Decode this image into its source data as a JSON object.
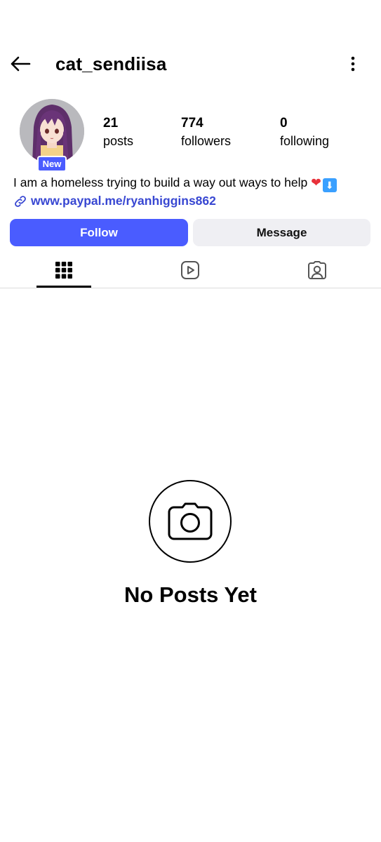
{
  "header": {
    "username": "cat_sendiisa",
    "back_icon": "arrow-left-icon",
    "more_icon": "more-vertical-icon"
  },
  "profile": {
    "badge": "New",
    "stats": {
      "posts": {
        "value": "21",
        "label": "posts"
      },
      "followers": {
        "value": "774",
        "label": "followers"
      },
      "following": {
        "value": "0",
        "label": "following"
      }
    },
    "bio": "I am a homeless trying to build a way out ways to help ",
    "bio_emoji_1": "❤",
    "bio_emoji_2": "⬇",
    "link": "www.paypal.me/ryanhiggins862"
  },
  "actions": {
    "follow_label": "Follow",
    "message_label": "Message"
  },
  "tabs": [
    {
      "icon": "grid-icon",
      "active": true
    },
    {
      "icon": "reels-icon",
      "active": false
    },
    {
      "icon": "tagged-icon",
      "active": false
    }
  ],
  "empty_state": {
    "icon": "camera-icon",
    "title": "No Posts Yet"
  },
  "colors": {
    "accent": "#4a5cff",
    "link": "#3847d2",
    "secondary_button": "#efeff3"
  }
}
